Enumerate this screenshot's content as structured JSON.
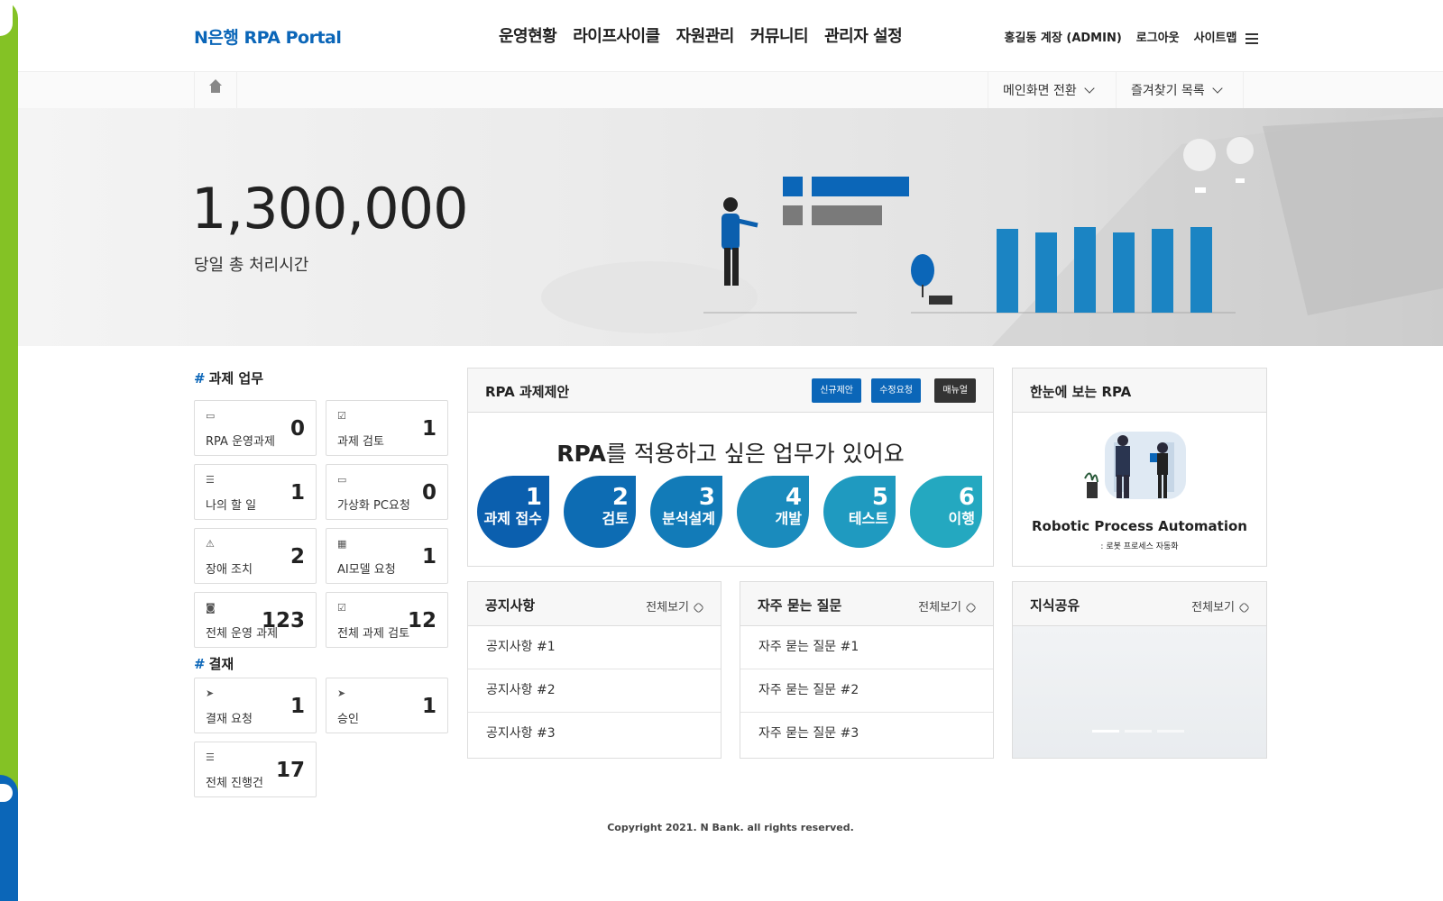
{
  "header": {
    "logo": "N은행 RPA Portal",
    "nav": [
      "운영현황",
      "라이프사이클",
      "자원관리",
      "커뮤니티",
      "관리자 설정"
    ],
    "user": "홍길동 계장 (ADMIN)",
    "logout": "로그아웃",
    "sitemap": "사이트맵"
  },
  "subbar": {
    "main_switch": "메인화면 전환",
    "favorites": "즐겨찾기 목록"
  },
  "hero": {
    "value": "1,300,000",
    "label": "당일 총 처리시간"
  },
  "tasks": {
    "title": "과제 업무",
    "hash": "#",
    "items": [
      {
        "label": "RPA 운영과제",
        "value": "0",
        "icon": "calendar-icon"
      },
      {
        "label": "과제 검토",
        "value": "1",
        "icon": "clipboard-icon"
      },
      {
        "label": "나의 할 일",
        "value": "1",
        "icon": "list-icon"
      },
      {
        "label": "가상화 PC요청",
        "value": "0",
        "icon": "monitor-icon"
      },
      {
        "label": "장애 조치",
        "value": "2",
        "icon": "warning-icon"
      },
      {
        "label": "AI모델 요청",
        "value": "1",
        "icon": "grid-icon"
      },
      {
        "label": "전체 운영 과제",
        "value": "123",
        "icon": "robot-icon"
      },
      {
        "label": "전체 과제 검토",
        "value": "12",
        "icon": "checklist-icon"
      }
    ]
  },
  "approval": {
    "title": "결재",
    "hash": "#",
    "items": [
      {
        "label": "결재 요청",
        "value": "1",
        "icon": "send-icon"
      },
      {
        "label": "승인",
        "value": "1",
        "icon": "send-approve-icon"
      },
      {
        "label": "전체 진행건",
        "value": "17",
        "icon": "list-icon"
      }
    ]
  },
  "proposal": {
    "title": "RPA 과제제안",
    "buttons": {
      "new": "신규제안",
      "modify": "수정요청",
      "manual": "매뉴얼"
    },
    "headline_bold": "RPA",
    "headline_rest": "를 적용하고 싶은 업무가 있어요",
    "steps": [
      {
        "num": "1",
        "label": "과제 접수",
        "color": "#0b5fae"
      },
      {
        "num": "2",
        "label": "검토",
        "color": "#0d6cb3"
      },
      {
        "num": "3",
        "label": "분석설계",
        "color": "#127bb8"
      },
      {
        "num": "4",
        "label": "개발",
        "color": "#1a8bbd"
      },
      {
        "num": "5",
        "label": "테스트",
        "color": "#1f9ac0"
      },
      {
        "num": "6",
        "label": "이행",
        "color": "#24a8c0"
      }
    ]
  },
  "rpa_overview": {
    "title": "한눈에 보는 RPA",
    "caption": "Robotic Process Automation",
    "sub": ": 로봇 프로세스 자동화"
  },
  "notice": {
    "title": "공지사항",
    "more": "전체보기",
    "items": [
      "공지사항 #1",
      "공지사항 #2",
      "공지사항 #3"
    ]
  },
  "faq": {
    "title": "자주 묻는 질문",
    "more": "전체보기",
    "items": [
      "자주 묻는 질문 #1",
      "자주 묻는 질문 #2",
      "자주 묻는 질문 #3"
    ]
  },
  "knowledge": {
    "title": "지식공유",
    "more": "전체보기"
  },
  "footer": {
    "copyright": "Copyright 2021. N Bank. all rights reserved."
  }
}
